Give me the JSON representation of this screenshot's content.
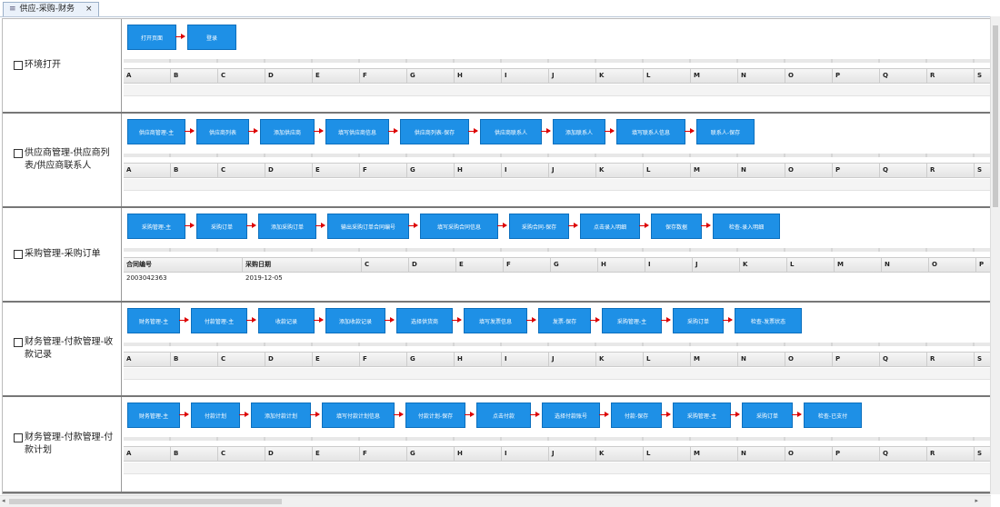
{
  "tab": {
    "label": "供应-采购-财务",
    "close": "×",
    "icon": "≡"
  },
  "columns": [
    "A",
    "B",
    "C",
    "D",
    "E",
    "F",
    "G",
    "H",
    "I",
    "J",
    "K",
    "L",
    "M",
    "N",
    "O",
    "P",
    "Q",
    "R",
    "S"
  ],
  "rows": [
    {
      "label": "环境打开",
      "steps": [
        "打开页面",
        "登录"
      ]
    },
    {
      "label": "供应商管理-供应商列表/供应商联系人",
      "steps": [
        "供应商管理-主",
        "供应商列表",
        "添加供应商",
        "填写供应商信息",
        "供应商列表-保存",
        "供应商联系人",
        "添加联系人",
        "填写联系人信息",
        "联系人-保存"
      ]
    },
    {
      "label": "采购管理-采购订单",
      "steps": [
        "采购管理-主",
        "采购订单",
        "添加采购订单",
        "输出采购订单合同编号",
        "填写采购合同信息",
        "采购合同-保存",
        "点击录入明细",
        "保存数据",
        "检查-录入明细"
      ],
      "data_headers": [
        "合同编号",
        "采购日期"
      ],
      "data_extra_cols": [
        "C",
        "D",
        "E",
        "F",
        "G",
        "H",
        "I",
        "J",
        "K",
        "L",
        "M",
        "N",
        "O",
        "P"
      ],
      "data_values": [
        "2003042363",
        "2019-12-05"
      ]
    },
    {
      "label": "财务管理-付款管理-收款记录",
      "steps": [
        "财务管理-主",
        "付款管理-主",
        "收款记录",
        "添加收款记录",
        "选择供货商",
        "填写发票信息",
        "发票-保存",
        "采购管理-主",
        "采购订单",
        "检查-发票状态"
      ]
    },
    {
      "label": "财务管理-付款管理-付款计划",
      "steps": [
        "财务管理-主",
        "付款计划",
        "添加付款计划",
        "填写付款计划信息",
        "付款计划-保存",
        "点击付款",
        "选择付款账号",
        "付款-保存",
        "采购管理-主",
        "采购订单",
        "检查-已支付"
      ]
    }
  ]
}
